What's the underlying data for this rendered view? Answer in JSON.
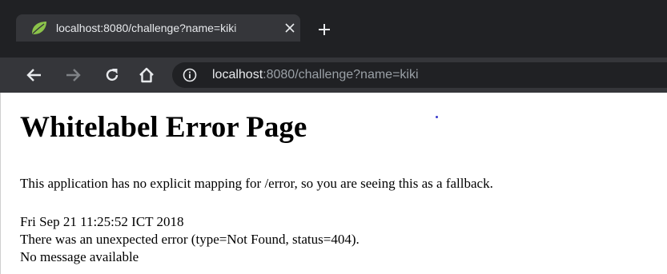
{
  "browser": {
    "tab": {
      "title": "localhost:8080/challenge?name=kiki",
      "favicon": "spring-leaf-icon",
      "close_icon": "close-icon"
    },
    "new_tab_icon": "plus-icon",
    "toolbar": {
      "back_icon": "arrow-left-icon",
      "forward_icon": "arrow-right-icon",
      "reload_icon": "reload-icon",
      "home_icon": "home-icon",
      "info_icon": "info-icon"
    },
    "address": {
      "host": "localhost",
      "rest": ":8080/challenge?name=kiki"
    }
  },
  "page": {
    "title": "Whitelabel Error Page",
    "message": "This application has no explicit mapping for /error, so you are seeing this as a fallback.",
    "timestamp": "Fri Sep 21 11:25:52 ICT 2018",
    "error_line": "There was an unexpected error (type=Not Found, status=404).",
    "detail": "No message available"
  },
  "colors": {
    "tabstrip": "#202124",
    "active_tab": "#35363a",
    "omnibox": "#202124",
    "favicon": "#8bc34a",
    "text_light": "#e8eaed",
    "text_dim": "#9aa0a6"
  }
}
